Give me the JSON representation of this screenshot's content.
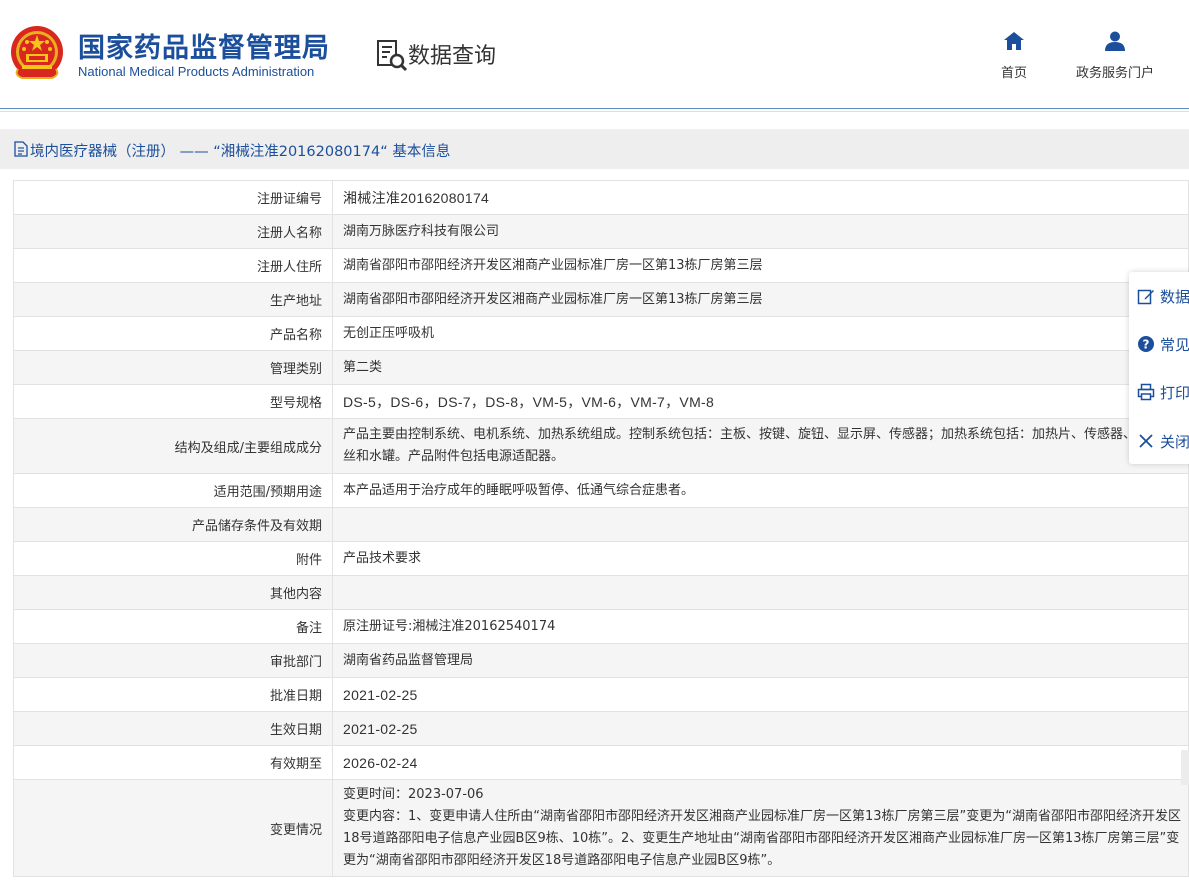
{
  "header": {
    "title_cn": "国家药品监督管理局",
    "title_en": "National Medical Products Administration",
    "emblem_icon": "national-emblem-icon",
    "query_label": "数据查询",
    "nav": [
      {
        "label": "首页",
        "icon": "home-icon"
      },
      {
        "label": "政务服务门户",
        "icon": "user-icon"
      }
    ],
    "brand_color": "#1b4f9c"
  },
  "breadcrumb": {
    "text": "境内医疗器械（注册） —— “湘械注准20162080174“ 基本信息"
  },
  "table": {
    "rows": [
      {
        "key": "注册证编号",
        "value": "湘械注准20162080174"
      },
      {
        "key": "注册人名称",
        "value": "湖南万脉医疗科技有限公司"
      },
      {
        "key": "注册人住所",
        "value": "湖南省邵阳市邵阳经济开发区湘商产业园标准厂房一区第13栋厂房第三层"
      },
      {
        "key": "生产地址",
        "value": "湖南省邵阳市邵阳经济开发区湘商产业园标准厂房一区第13栋厂房第三层"
      },
      {
        "key": "产品名称",
        "value": "无创正压呼吸机"
      },
      {
        "key": "管理类别",
        "value": "第二类"
      },
      {
        "key": "型号规格",
        "value": "DS-5，DS-6，DS-7，DS-8，VM-5，VM-6，VM-7，VM-8"
      },
      {
        "key": "结构及组成/主要组成成分",
        "value": "产品主要由控制系统、电机系统、加热系统组成。控制系统包括：主板、按键、旋钮、显示屏、传感器；加热系统包括：加热片、传感器、温度保险丝和水罐。产品附件包括电源适配器。"
      },
      {
        "key": "适用范围/预期用途",
        "value": "本产品适用于治疗成年的睡眠呼吸暂停、低通气综合症患者。"
      },
      {
        "key": "产品储存条件及有效期",
        "value": ""
      },
      {
        "key": "附件",
        "value": "产品技术要求"
      },
      {
        "key": "其他内容",
        "value": ""
      },
      {
        "key": "备注",
        "value": "原注册证号:湘械注准20162540174"
      },
      {
        "key": "审批部门",
        "value": "湖南省药品监督管理局"
      },
      {
        "key": "批准日期",
        "value": "2021-02-25"
      },
      {
        "key": "生效日期",
        "value": "2021-02-25"
      },
      {
        "key": "有效期至",
        "value": "2026-02-24"
      },
      {
        "key": "变更情况",
        "value_lines": [
          "变更时间：2023-07-06",
          "变更内容：1、变更申请人住所由“湖南省邵阳市邵阳经济开发区湘商产业园标准厂房一区第13栋厂房第三层”变更为“湖南省邵阳市邵阳经济开发区18号道路邵阳电子信息产业园B区9栋、10栋”。2、变更生产地址由“湖南省邵阳市邵阳经济开发区湘商产业园标准厂房一区第13栋厂房第三层”变更为“湖南省邵阳市邵阳经济开发区18号道路邵阳电子信息产业园B区9栋”。"
        ]
      }
    ]
  },
  "float_panel": {
    "items": [
      {
        "label": "数据",
        "icon": "edit-icon"
      },
      {
        "label": "常见",
        "icon": "help-icon"
      },
      {
        "label": "打印",
        "icon": "print-icon"
      },
      {
        "label": "关闭",
        "icon": "close-icon"
      }
    ]
  }
}
